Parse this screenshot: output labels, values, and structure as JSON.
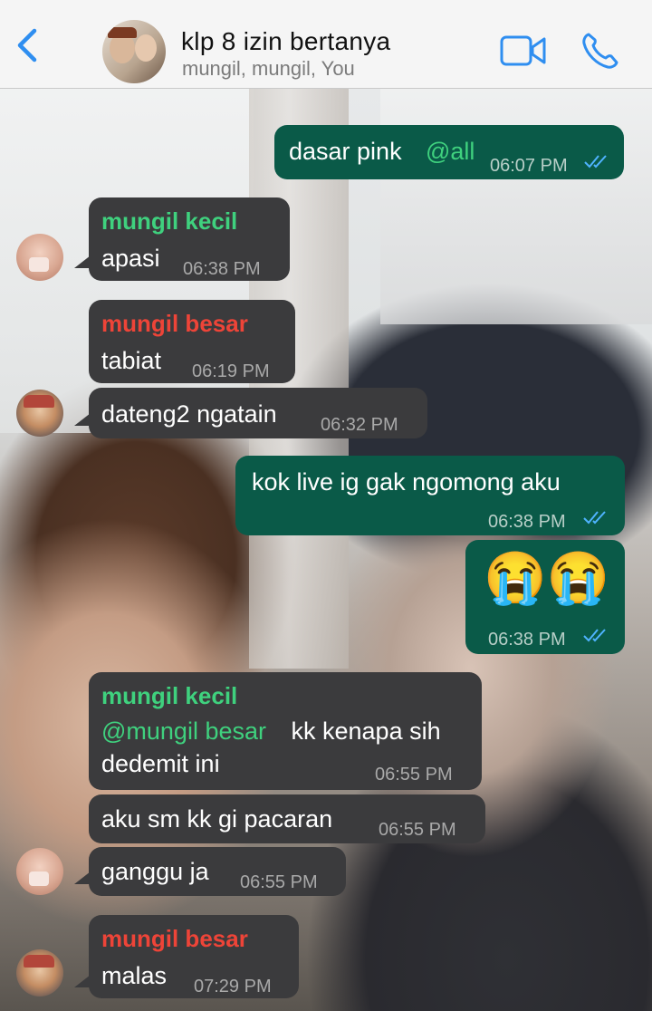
{
  "header": {
    "title": "klp 8 izin bertanya",
    "subtitle": "mungil, mungil, You",
    "accent": "#2f8ef0"
  },
  "messages": [
    {
      "id": "m1",
      "dir": "out",
      "text": "dasar pink ",
      "mention": "@all",
      "time": "06:07 PM"
    },
    {
      "id": "m2",
      "dir": "in",
      "sender": "mungil kecil",
      "text": "apasi",
      "time": "06:38 PM"
    },
    {
      "id": "m3",
      "dir": "in",
      "sender": "mungil besar",
      "text": "tabiat",
      "time": "06:19 PM"
    },
    {
      "id": "m4",
      "dir": "in",
      "text": "dateng2 ngatain",
      "time": "06:32 PM"
    },
    {
      "id": "m5",
      "dir": "out",
      "text": "kok live ig gak ngomong aku",
      "time": "06:38 PM"
    },
    {
      "id": "m6",
      "dir": "out",
      "text": "😭😭",
      "time": "06:38 PM"
    },
    {
      "id": "m7",
      "dir": "in",
      "sender": "mungil kecil",
      "mention": "@mungil besar",
      "text": " kk kenapa sih",
      "text2": "dedemit ini",
      "time": "06:55 PM"
    },
    {
      "id": "m8",
      "dir": "in",
      "text": "aku sm kk gi pacaran",
      "time": "06:55 PM"
    },
    {
      "id": "m9",
      "dir": "in",
      "text": "ganggu ja",
      "time": "06:55 PM"
    },
    {
      "id": "m10",
      "dir": "in",
      "sender": "mungil besar",
      "text": "malas",
      "time": "07:29 PM"
    }
  ],
  "colors": {
    "incoming_bubble": "#3b3b3d",
    "outgoing_bubble": "#0a5a48",
    "sender_kecil": "#3fd17e",
    "sender_besar": "#ee4438",
    "read_ticks": "#4fb3ff"
  }
}
